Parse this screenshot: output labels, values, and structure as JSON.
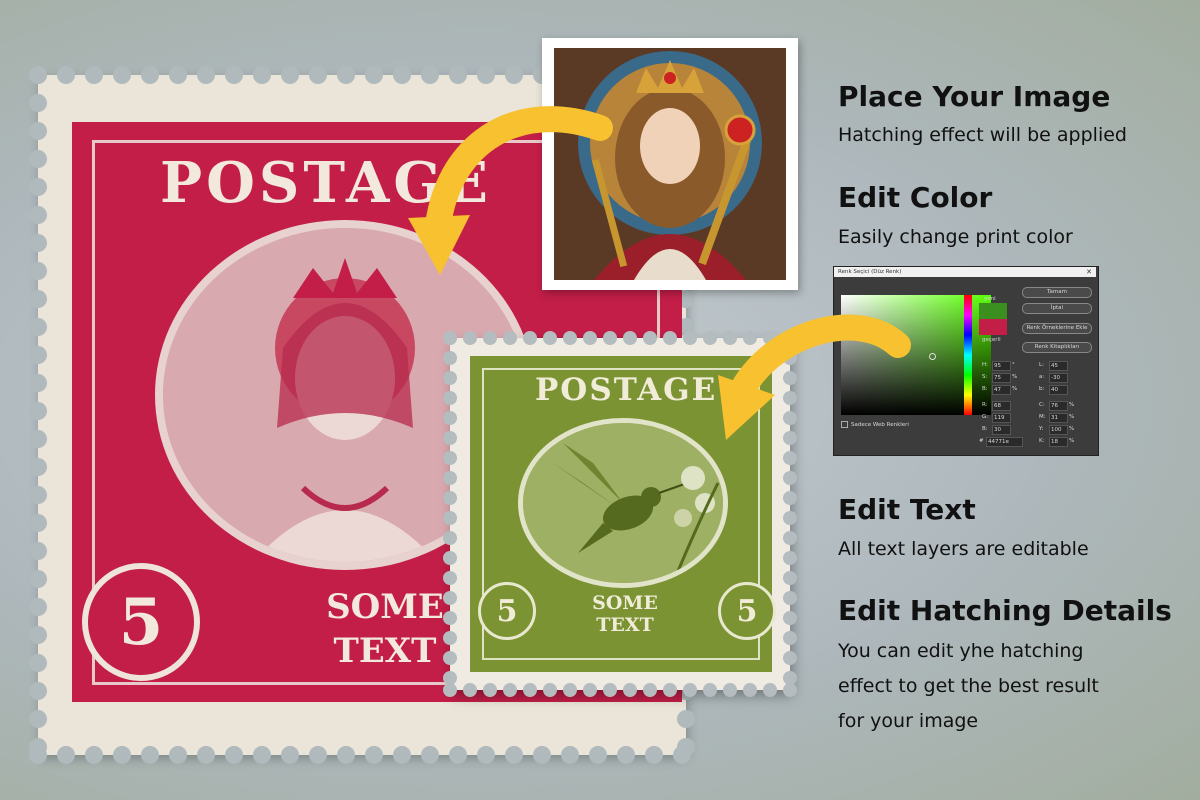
{
  "features": [
    {
      "title": "Place Your Image",
      "desc": [
        "Hatching effect will be applied"
      ]
    },
    {
      "title": "Edit Color",
      "desc": [
        "Easily change print color"
      ]
    },
    {
      "title": "Edit Text",
      "desc": [
        "All text layers are editable"
      ]
    },
    {
      "title": "Edit Hatching Details",
      "desc": [
        "You can edit yhe hatching",
        "effect to get the best result",
        "for your image"
      ]
    }
  ],
  "red_stamp": {
    "title": "POSTAGE",
    "value": "5",
    "text_line1": "SOME",
    "text_line2": "TEXT",
    "color": "#c21e48"
  },
  "green_stamp": {
    "title": "POSTAGE",
    "value_left": "5",
    "value_right": "5",
    "text_line1": "SOME",
    "text_line2": "TEXT",
    "color": "#7b9333"
  },
  "arrow_color": "#f7c12f",
  "color_picker": {
    "title": "Renk Seçici (Düz Renk)",
    "close": "✕",
    "new_label": "yeni",
    "current_label": "geçerli",
    "buttons": [
      "Tamam",
      "İptal",
      "Renk Örneklerine Ekle",
      "Renk Kitaplıkları"
    ],
    "fields_left": [
      {
        "label": "H:",
        "value": "95",
        "unit": "°"
      },
      {
        "label": "S:",
        "value": "75",
        "unit": "%"
      },
      {
        "label": "B:",
        "value": "47",
        "unit": "%"
      },
      {
        "label": "R:",
        "value": "68",
        "unit": ""
      },
      {
        "label": "G:",
        "value": "119",
        "unit": ""
      },
      {
        "label": "B:",
        "value": "30",
        "unit": ""
      }
    ],
    "fields_right": [
      {
        "label": "L:",
        "value": "45",
        "unit": ""
      },
      {
        "label": "a:",
        "value": "-30",
        "unit": ""
      },
      {
        "label": "b:",
        "value": "40",
        "unit": ""
      },
      {
        "label": "C:",
        "value": "76",
        "unit": "%"
      },
      {
        "label": "M:",
        "value": "31",
        "unit": "%"
      },
      {
        "label": "Y:",
        "value": "100",
        "unit": "%"
      },
      {
        "label": "K:",
        "value": "18",
        "unit": "%"
      }
    ],
    "web_only_label": "Sadece Web Renkleri",
    "hex_label": "#",
    "hex_value": "44771e",
    "new_color": "#3b8f1e",
    "current_color": "#c21e48"
  }
}
